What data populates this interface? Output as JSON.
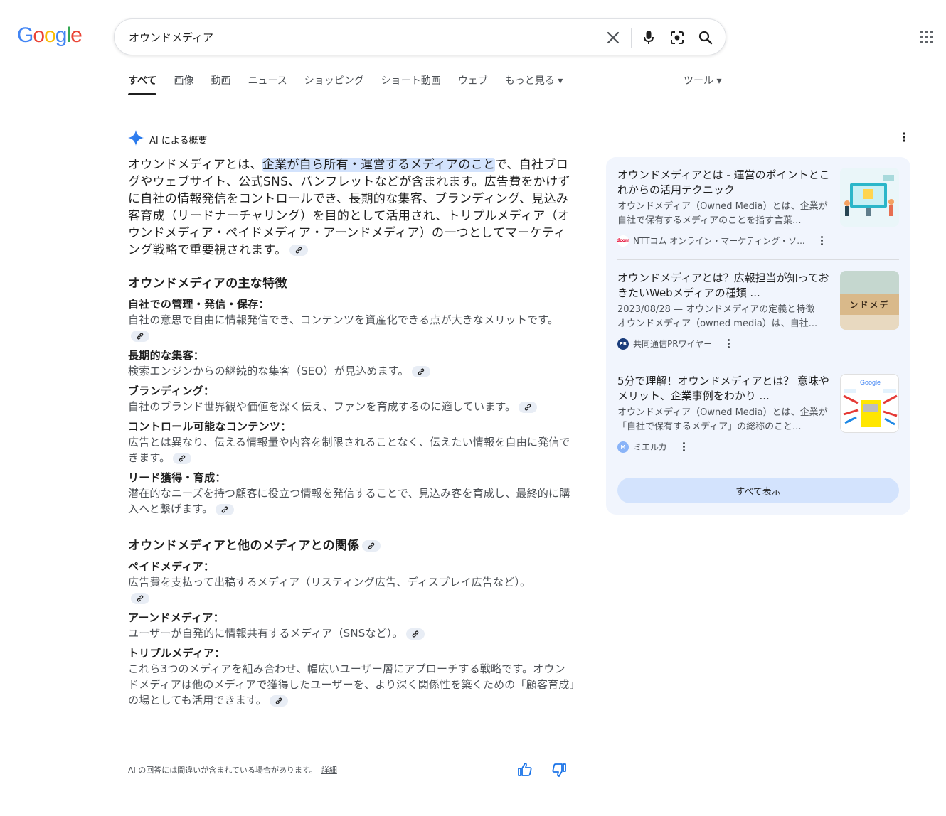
{
  "header": {
    "logo_letters": [
      "G",
      "o",
      "o",
      "g",
      "l",
      "e"
    ],
    "search_value": "オウンドメディア",
    "icons": [
      "close-icon",
      "mic-icon",
      "lens-icon",
      "search-icon",
      "apps-grid-icon"
    ]
  },
  "tabs": [
    {
      "label": "すべて",
      "active": true
    },
    {
      "label": "画像"
    },
    {
      "label": "動画"
    },
    {
      "label": "ニュース"
    },
    {
      "label": "ショッピング"
    },
    {
      "label": "ショート動画"
    },
    {
      "label": "ウェブ"
    },
    {
      "label": "もっと見る ▾"
    }
  ],
  "tools_label": "ツール ▾",
  "ai": {
    "label": "AI による概要",
    "intro_pre": "オウンドメディアとは、",
    "intro_highlight": "企業が自ら所有・運営するメディアのこと",
    "intro_post": "で、自社ブログやウェブサイト、公式SNS、パンフレットなどが含まれます。広告費をかけずに自社の情報発信をコントロールでき、長期的な集客、ブランディング、見込み客育成（リードナーチャリング）を目的として活用され、トリプルメディア（オウンドメディア・ペイドメディア・アーンドメディア）の一つとしてマーケティング戦略で重要視されます。",
    "section1_title": "オウンドメディアの主な特徴",
    "features": [
      {
        "title": "自社での管理・発信・保存：",
        "desc": "自社の意思で自由に情報発信でき、コンテンツを資産化できる点が大きなメリットです。"
      },
      {
        "title": "長期的な集客：",
        "desc": "検索エンジンからの継続的な集客（SEO）が見込めます。"
      },
      {
        "title": "ブランディング：",
        "desc": "自社のブランド世界観や価値を深く伝え、ファンを育成するのに適しています。"
      },
      {
        "title": "コントロール可能なコンテンツ：",
        "desc": "広告とは異なり、伝える情報量や内容を制限されることなく、伝えたい情報を自由に発信できます。"
      },
      {
        "title": "リード獲得・育成：",
        "desc": "潜在的なニーズを持つ顧客に役立つ情報を発信することで、見込み客を育成し、最終的に購入へと繋げます。"
      }
    ],
    "section2_title": "オウンドメディアと他のメディアとの関係",
    "relations": [
      {
        "title": "ペイドメディア：",
        "desc": "広告費を支払って出稿するメディア（リスティング広告、ディスプレイ広告など）。"
      },
      {
        "title": "アーンドメディア：",
        "desc": "ユーザーが自発的に情報共有するメディア（SNSなど）。"
      },
      {
        "title": "トリプルメディア：",
        "desc": "これら3つのメディアを組み合わせ、幅広いユーザー層にアプローチする戦略です。オウンドメディアは他のメディアで獲得したユーザーを、より深く関係性を築くための「顧客育成」の場としても活用できます。"
      }
    ],
    "disclaimer": "AI の回答には間違いが含まれている場合があります。",
    "disclaimer_link": "詳細"
  },
  "sources": {
    "cards": [
      {
        "title": "オウンドメディアとは - 運営のポイントとこれからの活用テクニック",
        "desc": "オウンドメディア（Owned Media）とは、企業が自社で保有するメディアのことを指す言葉...",
        "source": "NTTコム オンライン・マーケティング・ソ...",
        "favicon_text": "dcom",
        "favicon_color": "#e4002b"
      },
      {
        "title": "オウンドメディアとは？広報担当が知っておきたいWebメディアの種類 ...",
        "desc": "2023/08/28 — オウンドメディアの定義と特徴\nオウンドメディア（owned media）は、自社...",
        "source": "共同通信PRワイヤー",
        "favicon_text": "PR",
        "favicon_color": "#1a3d7c",
        "image_text": "ンドメデ"
      },
      {
        "title": "5分で理解！オウンドメディアとは？ 意味やメリット、企業事例をわかり ...",
        "desc": "オウンドメディア（Owned Media）とは、企業が「自社で保有するメディア」の総称のこと...",
        "source": "ミエルカ",
        "favicon_text": "M",
        "favicon_color": "#8ab4f8",
        "image_text": "Google"
      }
    ],
    "show_all": "すべて表示"
  }
}
